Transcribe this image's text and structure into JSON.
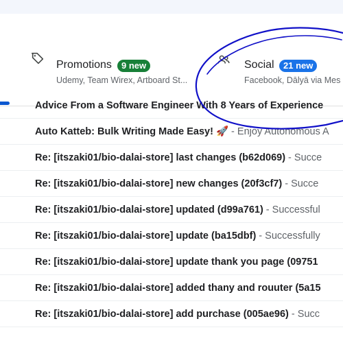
{
  "tabs": [
    {
      "title": "Promotions",
      "badge": "9 new",
      "subtitle": "Udemy, Team Wirex, Artboard St..."
    },
    {
      "title": "Social",
      "badge": "21 new",
      "subtitle": "Facebook, Dālyā via Mes"
    }
  ],
  "emails": [
    {
      "subject": "Advice From a Software Engineer With 8 Years of Experience",
      "snippet": ""
    },
    {
      "subject": "Auto Katteb: Bulk Writing Made Easy! 🚀",
      "snippet": " - Enjoy Autonomous A"
    },
    {
      "subject": "Re: [itszaki01/bio-dalai-store] last changes (b62d069)",
      "snippet": " - Succe"
    },
    {
      "subject": "Re: [itszaki01/bio-dalai-store] new changes (20f3cf7)",
      "snippet": " - Succe"
    },
    {
      "subject": "Re: [itszaki01/bio-dalai-store] updated (d99a761)",
      "snippet": " - Successful"
    },
    {
      "subject": "Re: [itszaki01/bio-dalai-store] update (ba15dbf)",
      "snippet": " - Successfully"
    },
    {
      "subject": "Re: [itszaki01/bio-dalai-store] update thank you page (09751",
      "snippet": ""
    },
    {
      "subject": "Re: [itszaki01/bio-dalai-store] added thany and rouuter (5a15",
      "snippet": ""
    },
    {
      "subject": "Re: [itszaki01/bio-dalai-store] add purchase (005ae96)",
      "snippet": " - Succ"
    }
  ],
  "colors": {
    "promotions_badge": "#188038",
    "social_badge": "#1a73e8",
    "scribble": "#1010c8"
  }
}
